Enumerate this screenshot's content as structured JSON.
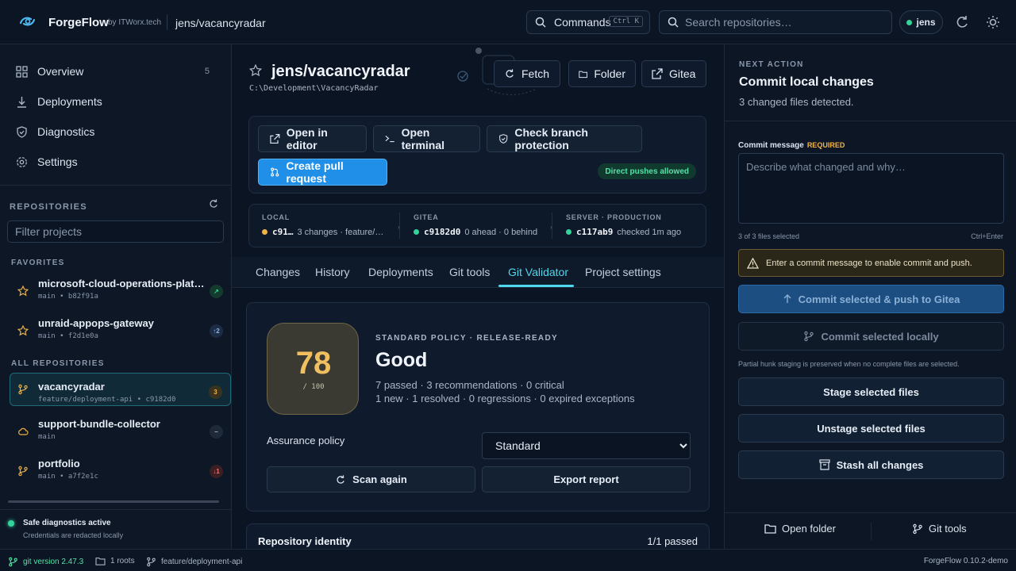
{
  "app": {
    "brand": "ForgeFlow",
    "by": "by ITWorx.tech",
    "breadcrumb": "jens/vacancyradar",
    "version": "ForgeFlow 0.10.2-demo"
  },
  "topbar": {
    "commands_label": "Commands",
    "commands_shortcut": "Ctrl K",
    "search_placeholder": "Search repositories…",
    "user": "jens",
    "icons": [
      "refresh-icon",
      "theme-icon"
    ]
  },
  "sidebar": {
    "nav": [
      {
        "label": "Overview",
        "count": "5",
        "icon": "grid-icon"
      },
      {
        "label": "Deployments",
        "icon": "download-icon"
      },
      {
        "label": "Diagnostics",
        "icon": "shield-icon"
      },
      {
        "label": "Settings",
        "icon": "gear-icon"
      }
    ],
    "repositories_label": "REPOSITORIES",
    "filter_placeholder": "Filter projects",
    "favorites_label": "FAVORITES",
    "favorites": [
      {
        "name": "microsoft-cloud-operations-platf…",
        "meta": "main • b82f91a",
        "badge": "↗",
        "badge_color": "#34d399"
      },
      {
        "name": "unraid-appops-gateway",
        "meta": "main • f2d1e0a",
        "badge": "↑2",
        "badge_color": "#8fb4e8"
      }
    ],
    "all_label": "ALL REPOSITORIES",
    "all": [
      {
        "name": "vacancyradar",
        "meta": "feature/deployment-api • c9182d0",
        "badge": "3",
        "badge_color": "#f0b34a",
        "icon": "branch-icon"
      },
      {
        "name": "support-bundle-collector",
        "meta": "main",
        "badge": "–",
        "badge_color": "#aab6c6",
        "icon": "cloud-icon"
      },
      {
        "name": "portfolio",
        "meta": "main • a7f2e1c",
        "badge": "↓1",
        "badge_color": "#f87171",
        "icon": "branch-icon"
      }
    ],
    "safe_title": "Safe diagnostics active",
    "safe_sub": "Credentials are redacted locally"
  },
  "header": {
    "title": "jens/vacancyradar",
    "path": "C:\\Development\\VacancyRadar",
    "fetch": "Fetch",
    "folder": "Folder",
    "gitea": "Gitea"
  },
  "actions": {
    "open_editor": "Open in editor",
    "open_terminal": "Open terminal",
    "check_branch": "Check branch protection",
    "create_pr": "Create pull request",
    "direct_push": "Direct pushes allowed"
  },
  "status": {
    "local": {
      "label": "LOCAL",
      "value": "c91…",
      "detail": "3 changes · feature/…",
      "color": "#f0b34a"
    },
    "gitea": {
      "label": "GITEA",
      "value": "c9182d0",
      "detail": "0 ahead · 0 behind",
      "color": "#34d399"
    },
    "server": {
      "label": "SERVER · PRODUCTION",
      "value": "c117ab9",
      "detail": "checked 1m ago",
      "color": "#34d399"
    }
  },
  "tabs": [
    {
      "label": "Changes"
    },
    {
      "label": "History"
    },
    {
      "label": "Deployments"
    },
    {
      "label": "Git tools"
    },
    {
      "label": "Git Validator"
    },
    {
      "label": "Project settings"
    }
  ],
  "active_tab": "Git Validator",
  "validator": {
    "score": "78",
    "score_max": "/ 100",
    "policy_label": "STANDARD POLICY · RELEASE-READY",
    "grade": "Good",
    "summary1": "7 passed · 3 recommendations · 0 critical",
    "summary2": "1 new · 1 resolved · 0 regressions · 0 expired exceptions",
    "assurance_label": "Assurance policy",
    "assurance_value": "Standard",
    "scan_again": "Scan again",
    "export_report": "Export report",
    "identity_label": "Repository identity",
    "identity_result": "1/1 passed"
  },
  "right": {
    "next_action_label": "NEXT ACTION",
    "title": "Commit local changes",
    "subtitle": "3 changed files detected.",
    "commit_label": "Commit message",
    "required": "REQUIRED",
    "commit_placeholder": "Describe what changed and why…",
    "files_selected": "3 of 3 files selected",
    "shortcut": "Ctrl+Enter",
    "warning": "Enter a commit message to enable commit and push.",
    "commit_push": "Commit selected & push to Gitea",
    "commit_local": "Commit selected locally",
    "hunk_note": "Partial hunk staging is preserved when no complete files are selected.",
    "stage": "Stage selected files",
    "unstage": "Unstage selected files",
    "stash": "Stash all changes",
    "open_folder": "Open folder",
    "git_tools": "Git tools"
  },
  "statusbar": {
    "git": "git version 2.47.3",
    "roots": "1 roots",
    "branch": "feature/deployment-api"
  }
}
